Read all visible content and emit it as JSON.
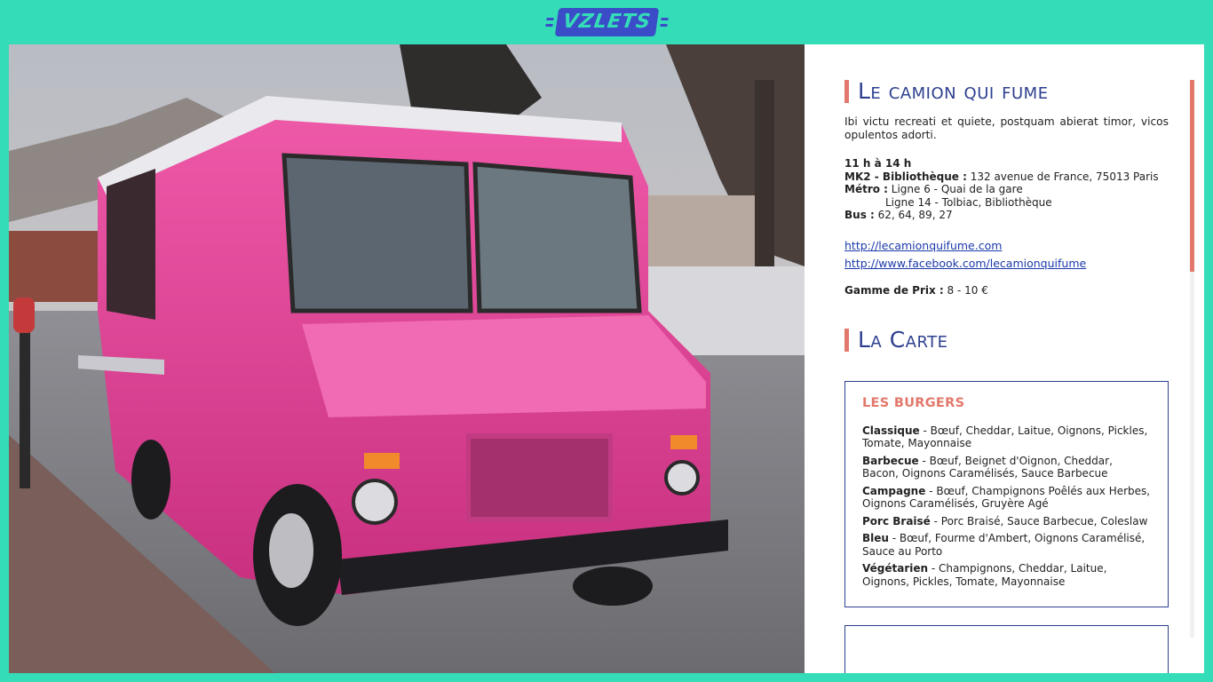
{
  "logo": {
    "text": "VZLETS"
  },
  "truck": {
    "title": "Le camion qui fume",
    "description": "Ibi victu recreati et quiete, postquam abierat timor, vicos opulentos adorti.",
    "hours": "11 h à 14 h",
    "venue_label": "MK2 - Bibliothèque :",
    "venue_value": " 132 avenue de France, 75013 Paris",
    "metro_label": "Métro :",
    "metro_line1": " Ligne 6 - Quai de la gare",
    "metro_line2": "Ligne 14 - Tolbiac, Bibliothèque",
    "bus_label": "Bus :",
    "bus_value": " 62, 64, 89, 27",
    "website": "http://lecamionquifume.com",
    "facebook": "http://www.facebook.com/lecamionquifume",
    "price_label": "Gamme de Prix :",
    "price_value": " 8 - 10 €"
  },
  "carte": {
    "title": "La Carte",
    "section_title": "LES BURGERS",
    "items": [
      {
        "name": "Classique",
        "desc": " - Bœuf, Cheddar, Laitue, Oignons, Pickles, Tomate, Mayonnaise"
      },
      {
        "name": "Barbecue",
        "desc": " - Bœuf, Beignet d'Oignon, Cheddar, Bacon, Oignons Caramélisés, Sauce Barbecue"
      },
      {
        "name": "Campagne",
        "desc": " - Bœuf, Champignons Poêlés aux Herbes, Oignons Caramélisés, Gruyère Agé"
      },
      {
        "name": "Porc Braisé",
        "desc": " - Porc Braisé, Sauce Barbecue, Coleslaw"
      },
      {
        "name": "Bleu",
        "desc": " - Bœuf, Fourme d'Ambert, Oignons Caramélisé, Sauce au Porto"
      },
      {
        "name": "Végétarien",
        "desc": " - Champignons, Cheddar, Laitue, Oignons, Pickles, Tomate, Mayonnaise"
      }
    ]
  },
  "colors": {
    "background": "#35dcb8",
    "accent": "#e2786b",
    "title_blue": "#2e3f8f",
    "link_blue": "#1c3aa9",
    "truck_pink": "#e8449a"
  }
}
